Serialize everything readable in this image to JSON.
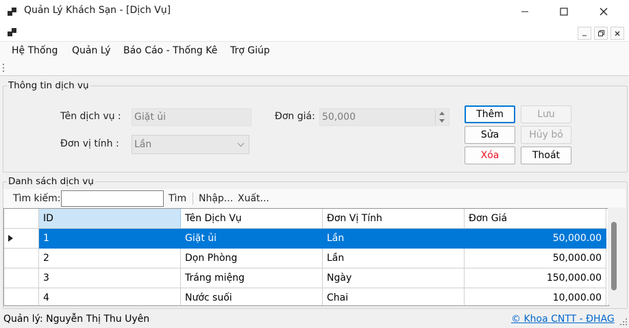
{
  "window": {
    "title": "Quản Lý Khách Sạn - [Dịch Vụ]"
  },
  "menu": [
    "Hệ Thống",
    "Quản Lý",
    "Báo Cáo - Thống Kê",
    "Trợ Giúp"
  ],
  "info_group": {
    "title": "Thông tin dịch vụ",
    "name_label": "Tên dịch vụ :",
    "name_value": "Giặt ủi",
    "unit_label": "Đơn vị tính :",
    "unit_value": "Lần",
    "price_label": "Đơn giá:",
    "price_value": "50,000"
  },
  "buttons": {
    "add": "Thêm",
    "save": "Lưu",
    "edit": "Sửa",
    "cancel": "Hủy bỏ",
    "delete": "Xóa",
    "exit": "Thoát"
  },
  "list_group": {
    "title": "Danh sách dịch vụ",
    "search_label": "Tìm kiếm:",
    "search_value": "",
    "search_button": "Tìm",
    "import": "Nhập...",
    "export": "Xuất..."
  },
  "table": {
    "columns": [
      "ID",
      "Tên Dịch Vụ",
      "Đơn Vị Tính",
      "Đơn Giá"
    ],
    "rows": [
      [
        "1",
        "Giặt ủi",
        "Lần",
        "50,000.00"
      ],
      [
        "2",
        "Dọn Phòng",
        "Lần",
        "50,000.00"
      ],
      [
        "3",
        "Tráng miệng",
        "Ngày",
        "150,000.00"
      ],
      [
        "4",
        "Nước suối",
        "Chai",
        "10,000.00"
      ]
    ],
    "selected_row": 0
  },
  "status": {
    "user": "Quản lý: Nguyễn Thị Thu Uyên",
    "credit": "© Khoa CNTT - ĐHAG"
  },
  "colors": {
    "selection": "#0078d7",
    "delete_text": "#e81123",
    "link": "#0066cc"
  }
}
